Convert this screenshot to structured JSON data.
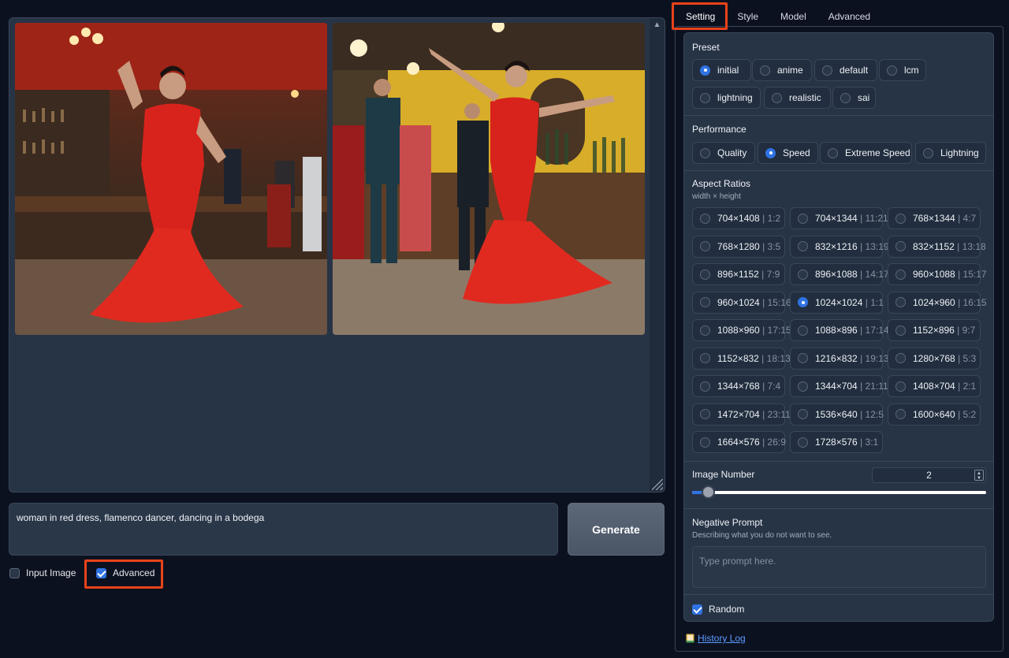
{
  "gallery": {
    "images": [
      {
        "name": "flamenco-image-1"
      },
      {
        "name": "flamenco-image-2"
      }
    ]
  },
  "prompt": {
    "value": "woman in red dress, flamenco dancer, dancing in a bodega"
  },
  "generate_label": "Generate",
  "options": {
    "input_image": {
      "label": "Input Image",
      "checked": false
    },
    "advanced": {
      "label": "Advanced",
      "checked": true
    }
  },
  "tabs": [
    "Setting",
    "Style",
    "Model",
    "Advanced"
  ],
  "active_tab": "Setting",
  "preset": {
    "title": "Preset",
    "options": [
      "initial",
      "anime",
      "default",
      "lcm",
      "lightning",
      "realistic",
      "sai"
    ],
    "selected": "initial"
  },
  "performance": {
    "title": "Performance",
    "options": [
      "Quality",
      "Speed",
      "Extreme Speed",
      "Lightning"
    ],
    "selected": "Speed"
  },
  "aspect_ratios": {
    "title": "Aspect Ratios",
    "subtitle": "width × height",
    "options": [
      {
        "dim": "704×1408",
        "ratio": "1:2"
      },
      {
        "dim": "704×1344",
        "ratio": "11:21"
      },
      {
        "dim": "768×1344",
        "ratio": "4:7"
      },
      {
        "dim": "768×1280",
        "ratio": "3:5"
      },
      {
        "dim": "832×1216",
        "ratio": "13:19"
      },
      {
        "dim": "832×1152",
        "ratio": "13:18"
      },
      {
        "dim": "896×1152",
        "ratio": "7:9"
      },
      {
        "dim": "896×1088",
        "ratio": "14:17"
      },
      {
        "dim": "960×1088",
        "ratio": "15:17"
      },
      {
        "dim": "960×1024",
        "ratio": "15:16"
      },
      {
        "dim": "1024×1024",
        "ratio": "1:1"
      },
      {
        "dim": "1024×960",
        "ratio": "16:15"
      },
      {
        "dim": "1088×960",
        "ratio": "17:15"
      },
      {
        "dim": "1088×896",
        "ratio": "17:14"
      },
      {
        "dim": "1152×896",
        "ratio": "9:7"
      },
      {
        "dim": "1152×832",
        "ratio": "18:13"
      },
      {
        "dim": "1216×832",
        "ratio": "19:13"
      },
      {
        "dim": "1280×768",
        "ratio": "5:3"
      },
      {
        "dim": "1344×768",
        "ratio": "7:4"
      },
      {
        "dim": "1344×704",
        "ratio": "21:11"
      },
      {
        "dim": "1408×704",
        "ratio": "2:1"
      },
      {
        "dim": "1472×704",
        "ratio": "23:11"
      },
      {
        "dim": "1536×640",
        "ratio": "12:5"
      },
      {
        "dim": "1600×640",
        "ratio": "5:2"
      },
      {
        "dim": "1664×576",
        "ratio": "26:9"
      },
      {
        "dim": "1728×576",
        "ratio": "3:1"
      }
    ],
    "selected": "1024×1024"
  },
  "image_number": {
    "title": "Image Number",
    "value": "2",
    "slider_fraction": 0.0
  },
  "negative_prompt": {
    "title": "Negative Prompt",
    "subtitle": "Describing what you do not want to see.",
    "placeholder": "Type prompt here."
  },
  "random": {
    "label": "Random",
    "checked": true
  },
  "history_log": "History Log",
  "colors": {
    "accent": "#2f73e3",
    "highlight": "#e8431a",
    "dress_red": "#d8231c"
  }
}
